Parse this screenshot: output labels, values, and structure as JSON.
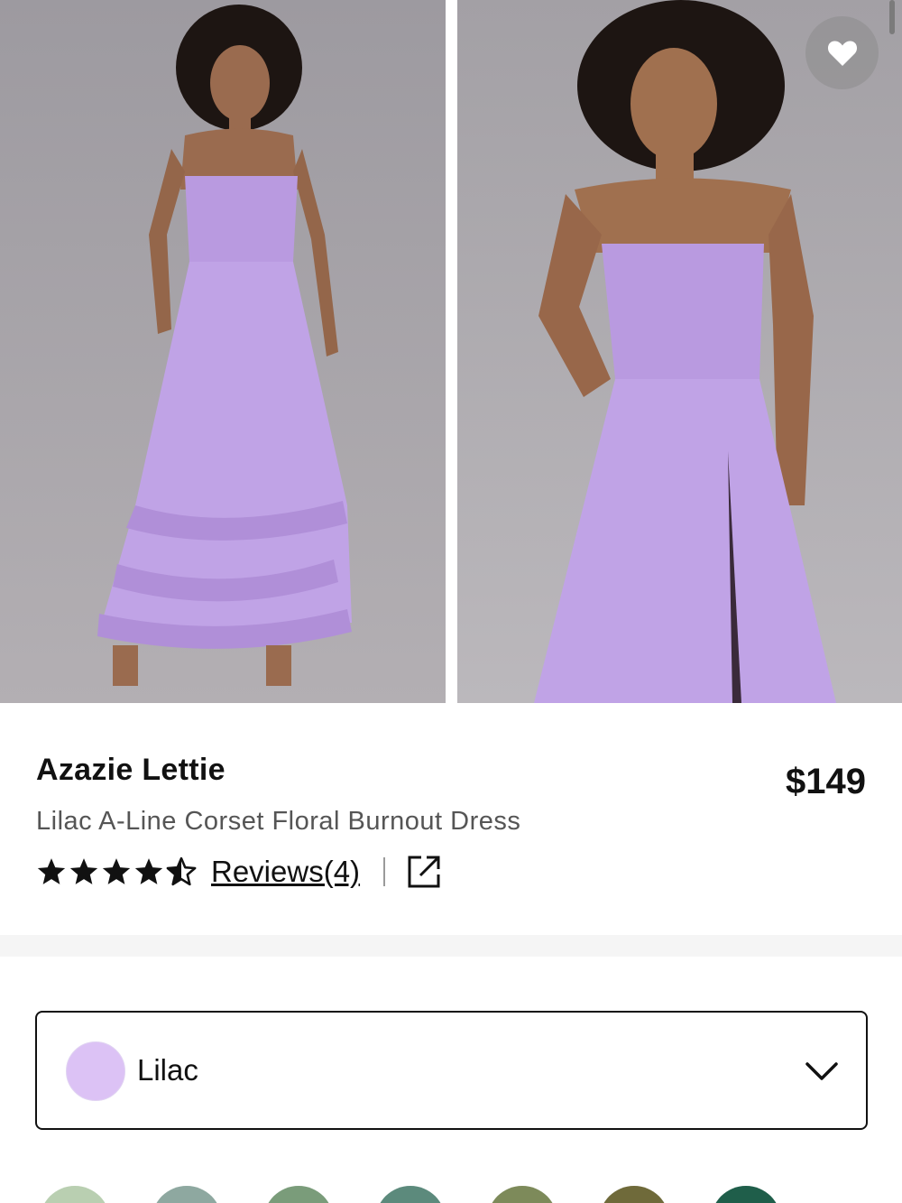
{
  "product": {
    "brand": "Azazie Lettie",
    "name": "Lilac A-Line Corset Floral Burnout Dress",
    "price": "$149",
    "rating": 4.5,
    "reviews_label": "Reviews(4)"
  },
  "gallery": {
    "images": [
      "dress-front-full-length",
      "dress-front-closeup"
    ],
    "favorite_icon": "heart-icon"
  },
  "color_selector": {
    "selected": "Lilac",
    "selected_color": "#dcc2f5",
    "chevron_icon": "chevron-down-icon"
  },
  "swatches": [
    {
      "color": "#b9cfb1"
    },
    {
      "color": "#8ea8a0"
    },
    {
      "color": "#7a9c7a"
    },
    {
      "color": "#5c8a7c"
    },
    {
      "color": "#7d8a5a"
    },
    {
      "color": "#6f6a3a"
    },
    {
      "color": "#1f5e4a"
    }
  ],
  "colors": {
    "dress": "#b99ae0",
    "background": "#a6a3a8",
    "text": "#111111",
    "subtext": "#555555"
  }
}
